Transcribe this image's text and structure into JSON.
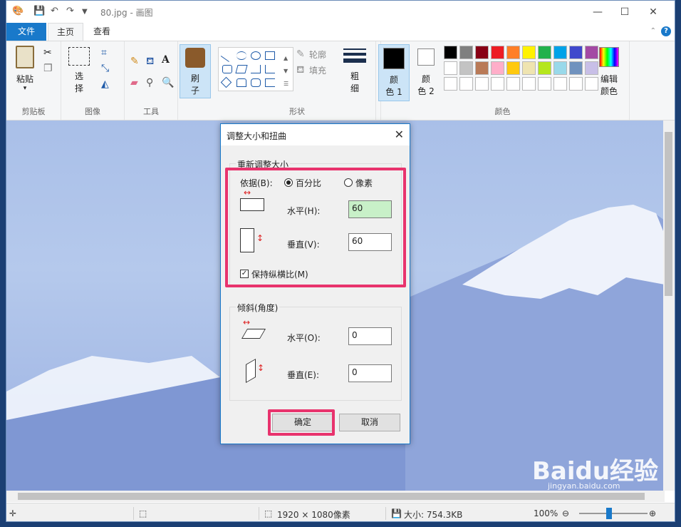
{
  "window": {
    "title": "80.jpg - 画图"
  },
  "tabs": {
    "file": "文件",
    "home": "主页",
    "view": "查看"
  },
  "ribbon": {
    "clipboard": {
      "paste": "粘贴",
      "label": "剪贴板"
    },
    "image": {
      "select": "选",
      "select2": "择",
      "label": "图像"
    },
    "tools": {
      "label": "工具"
    },
    "brushes": {
      "label1": "刷",
      "label2": "子"
    },
    "shapes": {
      "outline": "轮廓",
      "fill": "填充",
      "label": "形状"
    },
    "size": {
      "label1": "粗",
      "label2": "细"
    },
    "color1": {
      "l1": "颜",
      "l2": "色 1",
      "value": "#000000"
    },
    "color2": {
      "l1": "颜",
      "l2": "色 2",
      "value": "#ffffff"
    },
    "edit_colors": {
      "l1": "编辑",
      "l2": "颜色"
    },
    "colors_label": "颜色",
    "palette_row1": [
      "#000000",
      "#7f7f7f",
      "#880015",
      "#ed1c24",
      "#ff7f27",
      "#fff200",
      "#22b14c",
      "#00a2e8",
      "#3f48cc",
      "#a349a4"
    ],
    "palette_row2": [
      "#ffffff",
      "#c3c3c3",
      "#b97a57",
      "#ffaec9",
      "#ffc90e",
      "#efe4b0",
      "#b5e61d",
      "#99d9ea",
      "#7092be",
      "#c8bfe7"
    ]
  },
  "status": {
    "dimensions": "1920 × 1080像素",
    "size": "大小: 754.3KB",
    "zoom": "100%"
  },
  "dialog": {
    "title": "调整大小和扭曲",
    "resize_legend": "重新调整大小",
    "by_label": "依据(B):",
    "percent": "百分比",
    "pixels": "像素",
    "horizontal": "水平(H):",
    "horizontal_value": "60",
    "vertical": "垂直(V):",
    "vertical_value": "60",
    "keep_ratio": "保持纵横比(M)",
    "skew_legend": "倾斜(角度)",
    "skew_h": "水平(O):",
    "skew_h_value": "0",
    "skew_v": "垂直(E):",
    "skew_v_value": "0",
    "ok": "确定",
    "cancel": "取消"
  },
  "watermark": {
    "brand": "Baidu经验",
    "url": "jingyan.baidu.com"
  }
}
